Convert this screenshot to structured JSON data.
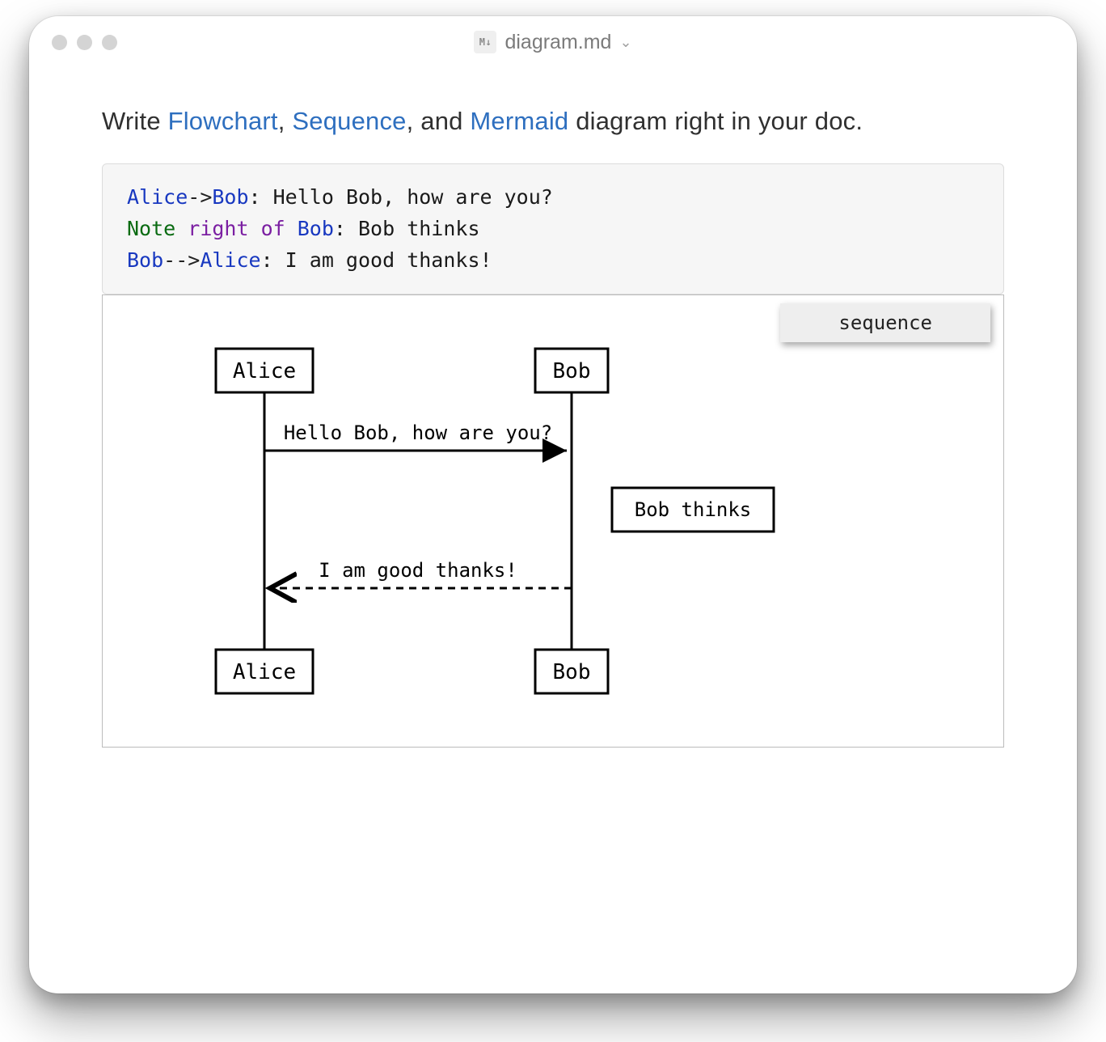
{
  "titlebar": {
    "file_badge": "M↓",
    "filename": "diagram.md"
  },
  "intro": {
    "prefix": "Write ",
    "link1": "Flowchart",
    "sep1": ", ",
    "link2": "Sequence",
    "sep2": ", and ",
    "link3": "Mermaid",
    "suffix": " diagram right in your doc."
  },
  "code": {
    "l1_actor1": "Alice",
    "l1_arrow": "->",
    "l1_actor2": "Bob",
    "l1_rest": ": Hello Bob, how are you?",
    "l2_note": "Note",
    "l2_kw": " right of ",
    "l2_actor": "Bob",
    "l2_rest": ": Bob thinks",
    "l3_actor1": "Bob",
    "l3_arrow": "-->",
    "l3_actor2": "Alice",
    "l3_rest": ": I am good thanks!"
  },
  "diagram": {
    "type_badge": "sequence",
    "actors": {
      "a": "Alice",
      "b": "Bob"
    },
    "msg1": "Hello Bob, how are you?",
    "note": "Bob thinks",
    "msg2": "I am good thanks!"
  },
  "chart_data": {
    "type": "sequence",
    "actors": [
      "Alice",
      "Bob"
    ],
    "events": [
      {
        "kind": "message",
        "from": "Alice",
        "to": "Bob",
        "style": "solid",
        "text": "Hello Bob, how are you?"
      },
      {
        "kind": "note",
        "placement": "right of",
        "actor": "Bob",
        "text": "Bob thinks"
      },
      {
        "kind": "message",
        "from": "Bob",
        "to": "Alice",
        "style": "dashed",
        "text": "I am good thanks!"
      }
    ]
  }
}
